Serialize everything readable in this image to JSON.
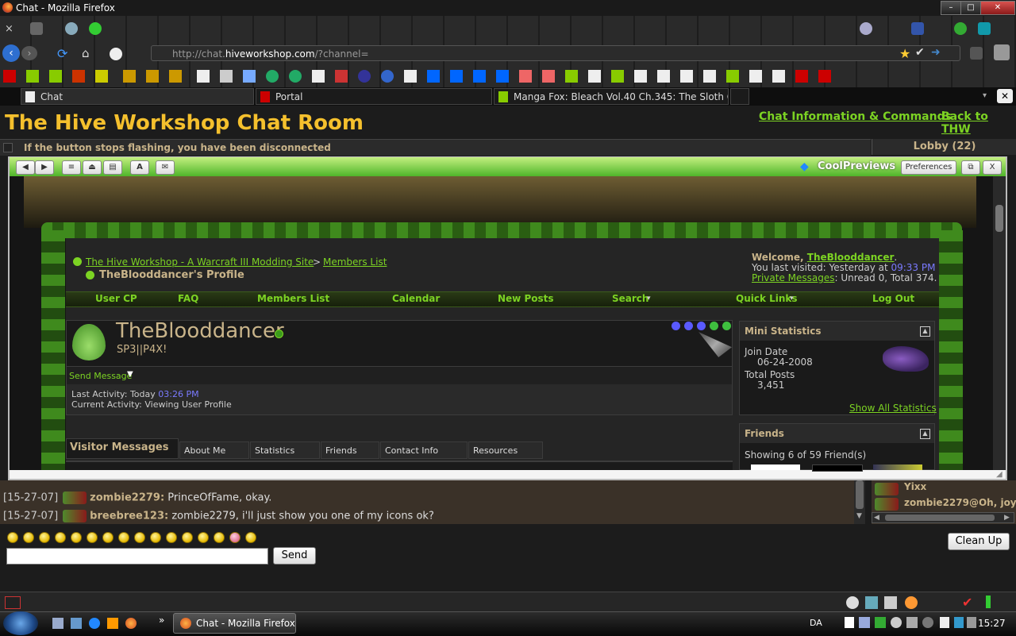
{
  "window": {
    "title": "Chat - Mozilla Firefox"
  },
  "browser": {
    "url_prefix": "http://chat.",
    "url_domain": "hiveworkshop.com",
    "url_suffix": "/?channel="
  },
  "tabs": [
    {
      "label": "Chat"
    },
    {
      "label": "Portal"
    },
    {
      "label": "Manga Fox: Bleach Vol.40 Ch.345: The Sloth Onli..."
    }
  ],
  "page": {
    "title": "The Hive Workshop Chat Room",
    "link_info": "Chat Information & Commands",
    "link_back": "Back to THW",
    "disconnect_notice": "If the button stops flashing, you have been disconnected",
    "lobby": "Lobby (22)"
  },
  "coolpreviews": {
    "title": "CoolPreviews",
    "preferences": "Preferences",
    "close": "X"
  },
  "profile": {
    "breadcrumb_site": "The Hive Workshop - A Warcraft III Modding Site",
    "breadcrumb_sep": ">",
    "breadcrumb_members": "Members List",
    "profile_heading": "TheBlooddancer's Profile",
    "welcome_prefix": "Welcome, ",
    "welcome_user": "TheBlooddancer",
    "welcome_suffix": ".",
    "last_visited": "You last visited: Yesterday at ",
    "last_visited_time": "09:33 PM",
    "pm_link": "Private Messages",
    "pm_counts": ": Unread 0, Total 374.",
    "nav": [
      "User CP",
      "FAQ",
      "Members List",
      "Calendar",
      "New Posts",
      "Search",
      "Quick Links",
      "Log Out"
    ],
    "username": "TheBlooddancer",
    "usertitle": "SP3||P4X!",
    "send_message": "Send Message",
    "last_activity_label": "Last Activity: Today ",
    "last_activity_time": "03:26 PM",
    "current_activity": "Current Activity: Viewing User Profile",
    "tabs": [
      "Visitor Messages",
      "About Me",
      "Statistics",
      "Friends",
      "Contact Info",
      "Resources"
    ],
    "mini_stats_title": "Mini Statistics",
    "join_date_label": "Join Date",
    "join_date": "06-24-2008",
    "total_posts_label": "Total Posts",
    "total_posts": "3,451",
    "show_all_stats": "Show All Statistics",
    "friends_title": "Friends",
    "friends_showing": "Showing 6 of 59 Friend(s)"
  },
  "chat": {
    "lines": [
      {
        "ts": "[15-27-07]",
        "nick": "zombie2279:",
        "msg": " PrinceOfFame, okay."
      },
      {
        "ts": "[15-27-07]",
        "nick": "breebree123:",
        "msg": " zombie2279, i'll just show you one of my icons ok?"
      }
    ],
    "users": [
      {
        "name": "Yixx"
      },
      {
        "name": "zombie2279@Oh, joy"
      }
    ],
    "send": "Send",
    "cleanup": "Clean Up"
  },
  "taskbar": {
    "button": "Chat - Mozilla Firefox",
    "lang": "DA",
    "clock": "15:27"
  }
}
